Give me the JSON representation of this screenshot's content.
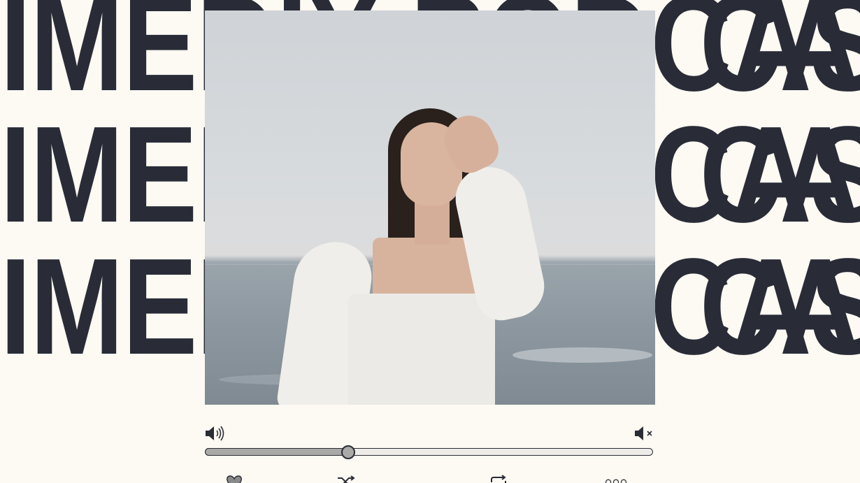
{
  "background": {
    "headline_rows": [
      {
        "left": "IMEDIX PODCAST",
        "right": "CAST"
      },
      {
        "left": "IMEDIX PODCAST",
        "right": "CAST"
      },
      {
        "left": "IMEDIX PODCAST",
        "right": "CAST"
      }
    ]
  },
  "cover": {
    "subject": "podcast-cover-image"
  },
  "player": {
    "progress_fraction": 0.32,
    "volume_up_icon": "volume-up-icon",
    "volume_mute_icon": "volume-mute-icon",
    "bottom_icons": [
      "heart-icon",
      "shuffle-icon",
      "repeat-icon",
      "more-icon"
    ]
  },
  "colors": {
    "background": "#fdf9f3",
    "headline": "#292c37",
    "track_fill": "#a9a9a7",
    "track_empty": "#eeece8",
    "outline": "#2b2d35"
  }
}
